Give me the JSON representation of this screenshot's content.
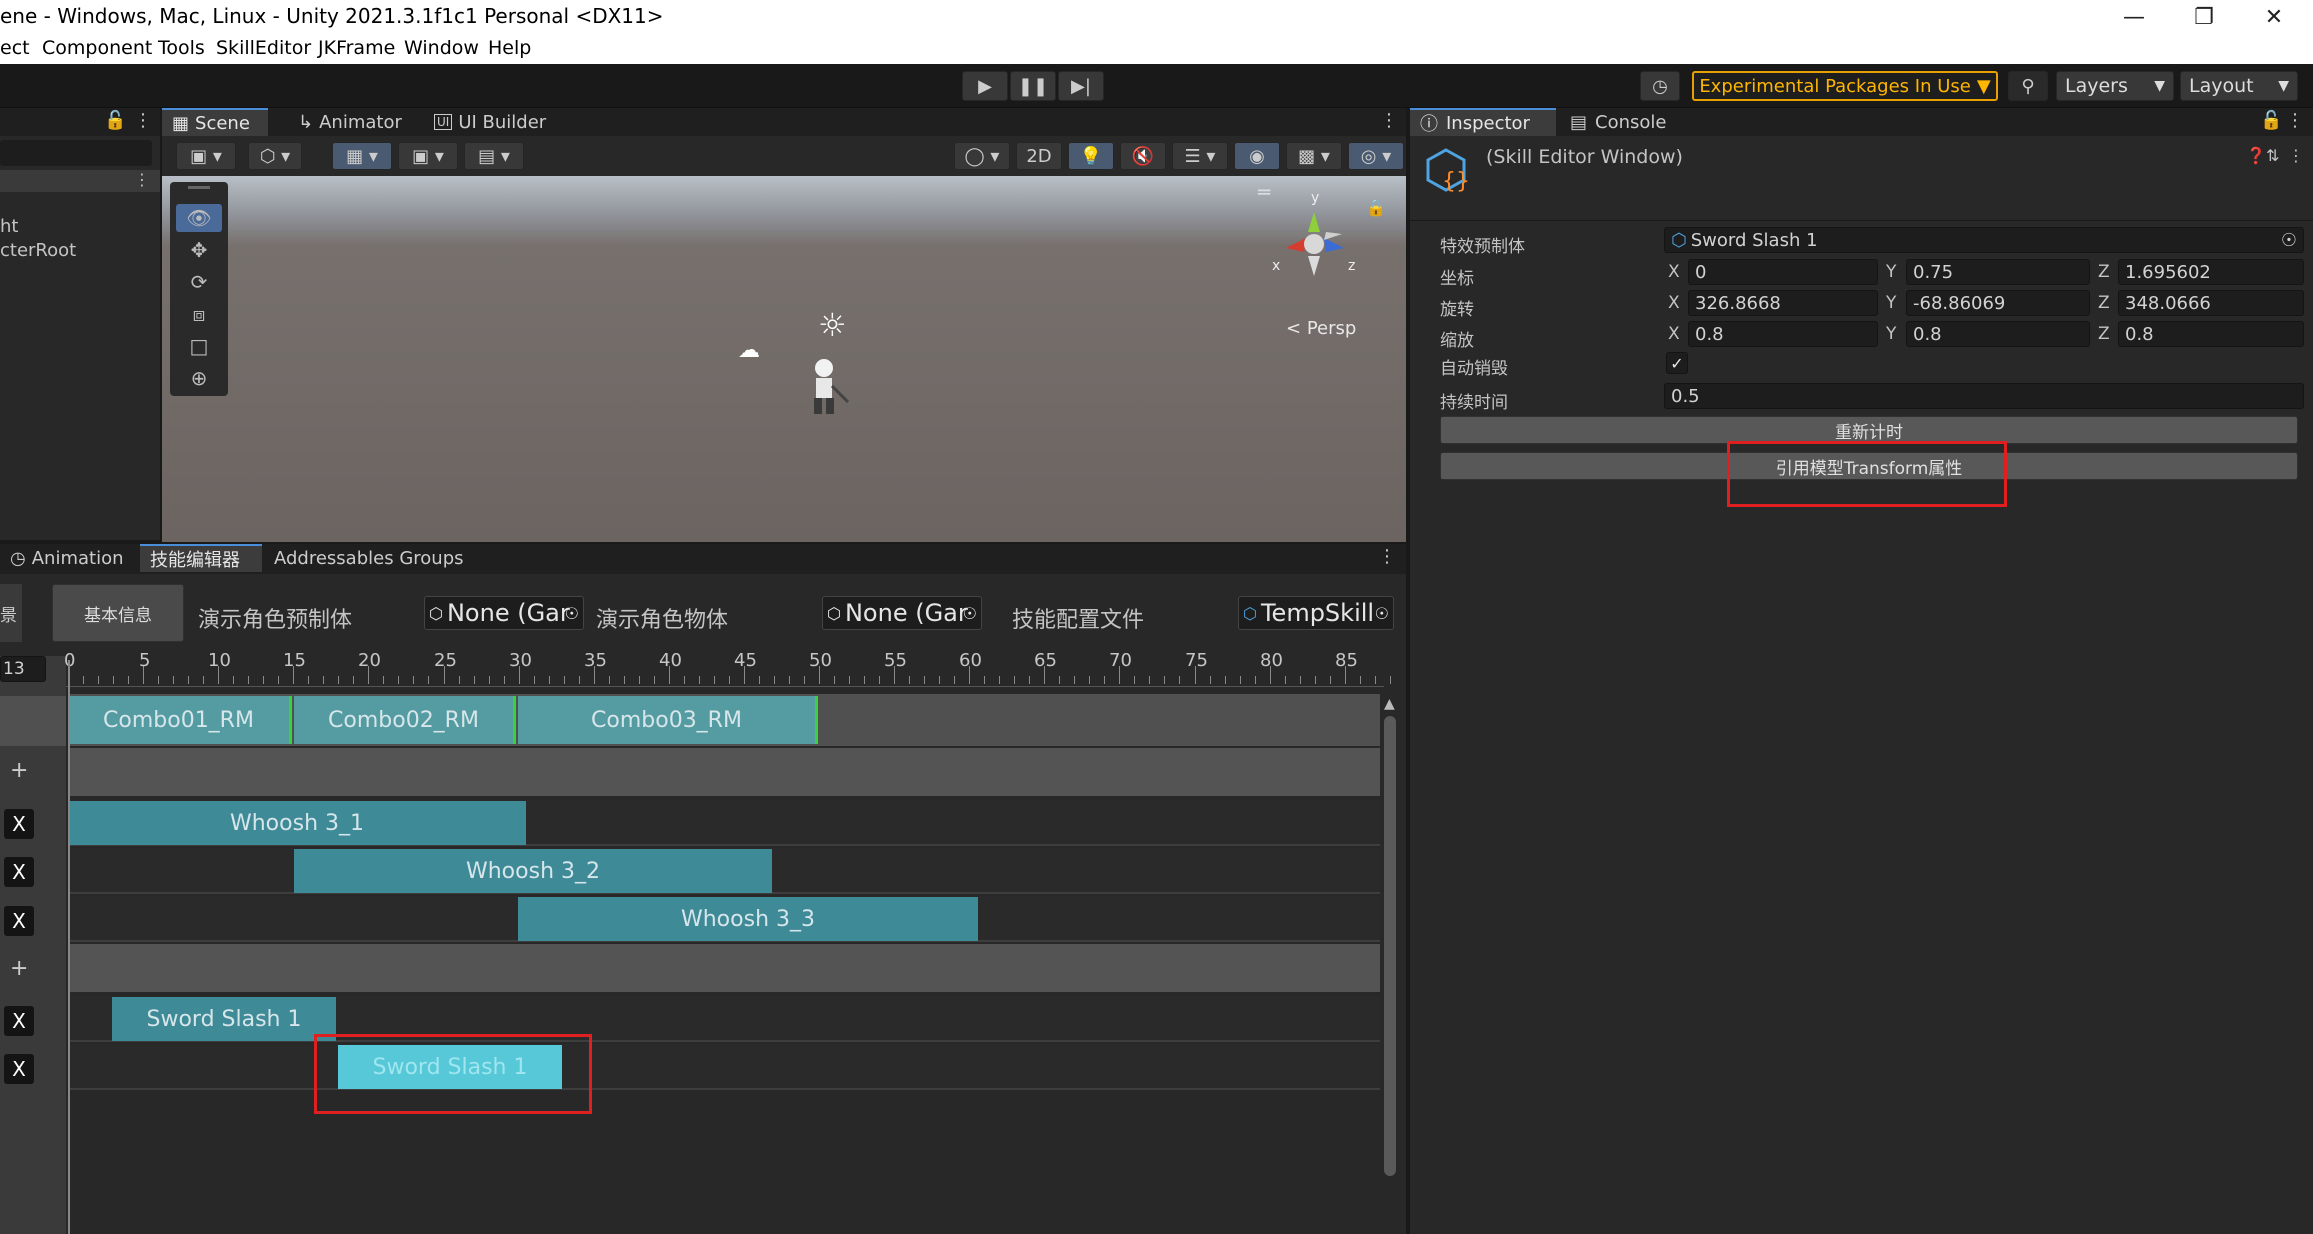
{
  "window": {
    "title": "ene - Windows, Mac, Linux - Unity 2021.3.1f1c1 Personal <DX11>"
  },
  "menu": [
    "ect",
    "Component",
    "Tools",
    "SkillEditor",
    "JKFrame",
    "Window",
    "Help"
  ],
  "toolbar": {
    "experimental": "Experimental Packages In Use",
    "layers": "Layers",
    "layout": "Layout"
  },
  "scene_tabs": [
    "Scene",
    "Animator",
    "UI Builder"
  ],
  "scene": {
    "persp": "Persp",
    "btn_2d": "2D",
    "hierarchy_items": [
      "ht",
      "cterRoot"
    ],
    "gizmo": {
      "y": "y",
      "x": "x",
      "z": "z"
    }
  },
  "inspector": {
    "tabs": [
      "Inspector",
      "Console"
    ],
    "header": "(Skill Editor Window)",
    "prefab_label": "特效预制体",
    "prefab_value": "Sword Slash 1",
    "rows": [
      {
        "label": "坐标",
        "x": "0",
        "y": "0.75",
        "z": "1.695602"
      },
      {
        "label": "旋转",
        "x": "326.8668",
        "y": "-68.86069",
        "z": "348.0666"
      },
      {
        "label": "缩放",
        "x": "0.8",
        "y": "0.8",
        "z": "0.8"
      }
    ],
    "axis": {
      "x": "X",
      "y": "Y",
      "z": "Z"
    },
    "auto_destroy_label": "自动销毁",
    "auto_destroy": true,
    "duration_label": "持续时间",
    "duration_value": "0.5",
    "btn_reset": "重新计时",
    "btn_ref": "引用模型Transform属性"
  },
  "bottom": {
    "tabs": [
      "Animation",
      "技能编辑器",
      "Addressables Groups"
    ],
    "left_cut": "景",
    "btn_basic": "基本信息",
    "label_role_prefab": "演示角色预制体",
    "role_prefab": "None (Gar",
    "label_role_obj": "演示角色物体",
    "role_obj": "None (Gar",
    "label_config": "技能配置文件",
    "config": "TempSkill",
    "frame": "13",
    "ticks": [
      "0",
      "5",
      "10",
      "15",
      "20",
      "25",
      "30",
      "35",
      "40",
      "45",
      "50",
      "55",
      "60",
      "65",
      "70",
      "75",
      "80",
      "85"
    ],
    "anim_clips": [
      "Combo01_RM",
      "Combo02_RM",
      "Combo03_RM"
    ],
    "audio_clips": [
      "Whoosh 3_1",
      "Whoosh 3_2",
      "Whoosh 3_3"
    ],
    "effect_clips": [
      "Sword Slash 1",
      "Sword Slash 1"
    ],
    "x_label": "X",
    "plus": "+"
  }
}
